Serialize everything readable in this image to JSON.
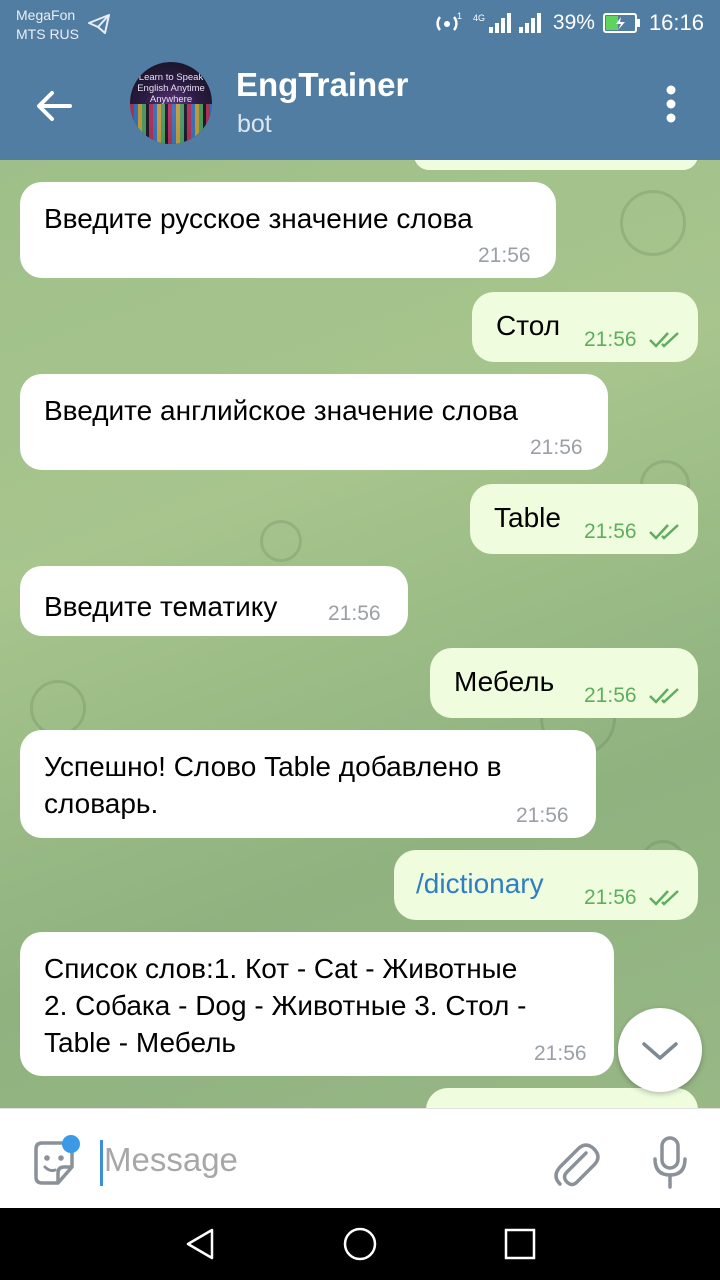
{
  "status_bar": {
    "carrier_1": "MegaFon",
    "carrier_2": "MTS RUS",
    "battery": "39%",
    "time": "16:16"
  },
  "header": {
    "title": "EngTrainer",
    "subtitle": "bot",
    "avatar_text": "Learn to Speak English Anytime Anywhere",
    "color": "#527da3"
  },
  "messages": [
    {
      "side": "in",
      "text": "Введите русское значение слова",
      "time": "21:56"
    },
    {
      "side": "out",
      "text": "Стол",
      "time": "21:56",
      "read": true
    },
    {
      "side": "in",
      "text": "Введите английское значение слова",
      "time": "21:56"
    },
    {
      "side": "out",
      "text": "Table",
      "time": "21:56",
      "read": true
    },
    {
      "side": "in",
      "text": "Введите тематику",
      "time": "21:56"
    },
    {
      "side": "out",
      "text": "Мебель",
      "time": "21:56",
      "read": true
    },
    {
      "side": "in",
      "text_line1": "Успешно! Слово Table добавлено в",
      "text_line2": "словарь.",
      "time": "21:56"
    },
    {
      "side": "out",
      "text": "/dictionary",
      "time": "21:56",
      "read": true
    },
    {
      "side": "in",
      "text_line1": "Список слов:1. Кот - Cat - Животные",
      "text_line2": "2. Собака - Dog - Животные 3. Стол -",
      "text_line3": "Table - Мебель",
      "time": "21:56"
    }
  ],
  "input": {
    "placeholder": "Message"
  },
  "icons": [
    "back-arrow-icon",
    "more-vert-icon",
    "chevron-down-icon",
    "sticker-icon",
    "attach-icon",
    "mic-icon",
    "nav-back-icon",
    "nav-home-icon",
    "nav-recents-icon"
  ]
}
